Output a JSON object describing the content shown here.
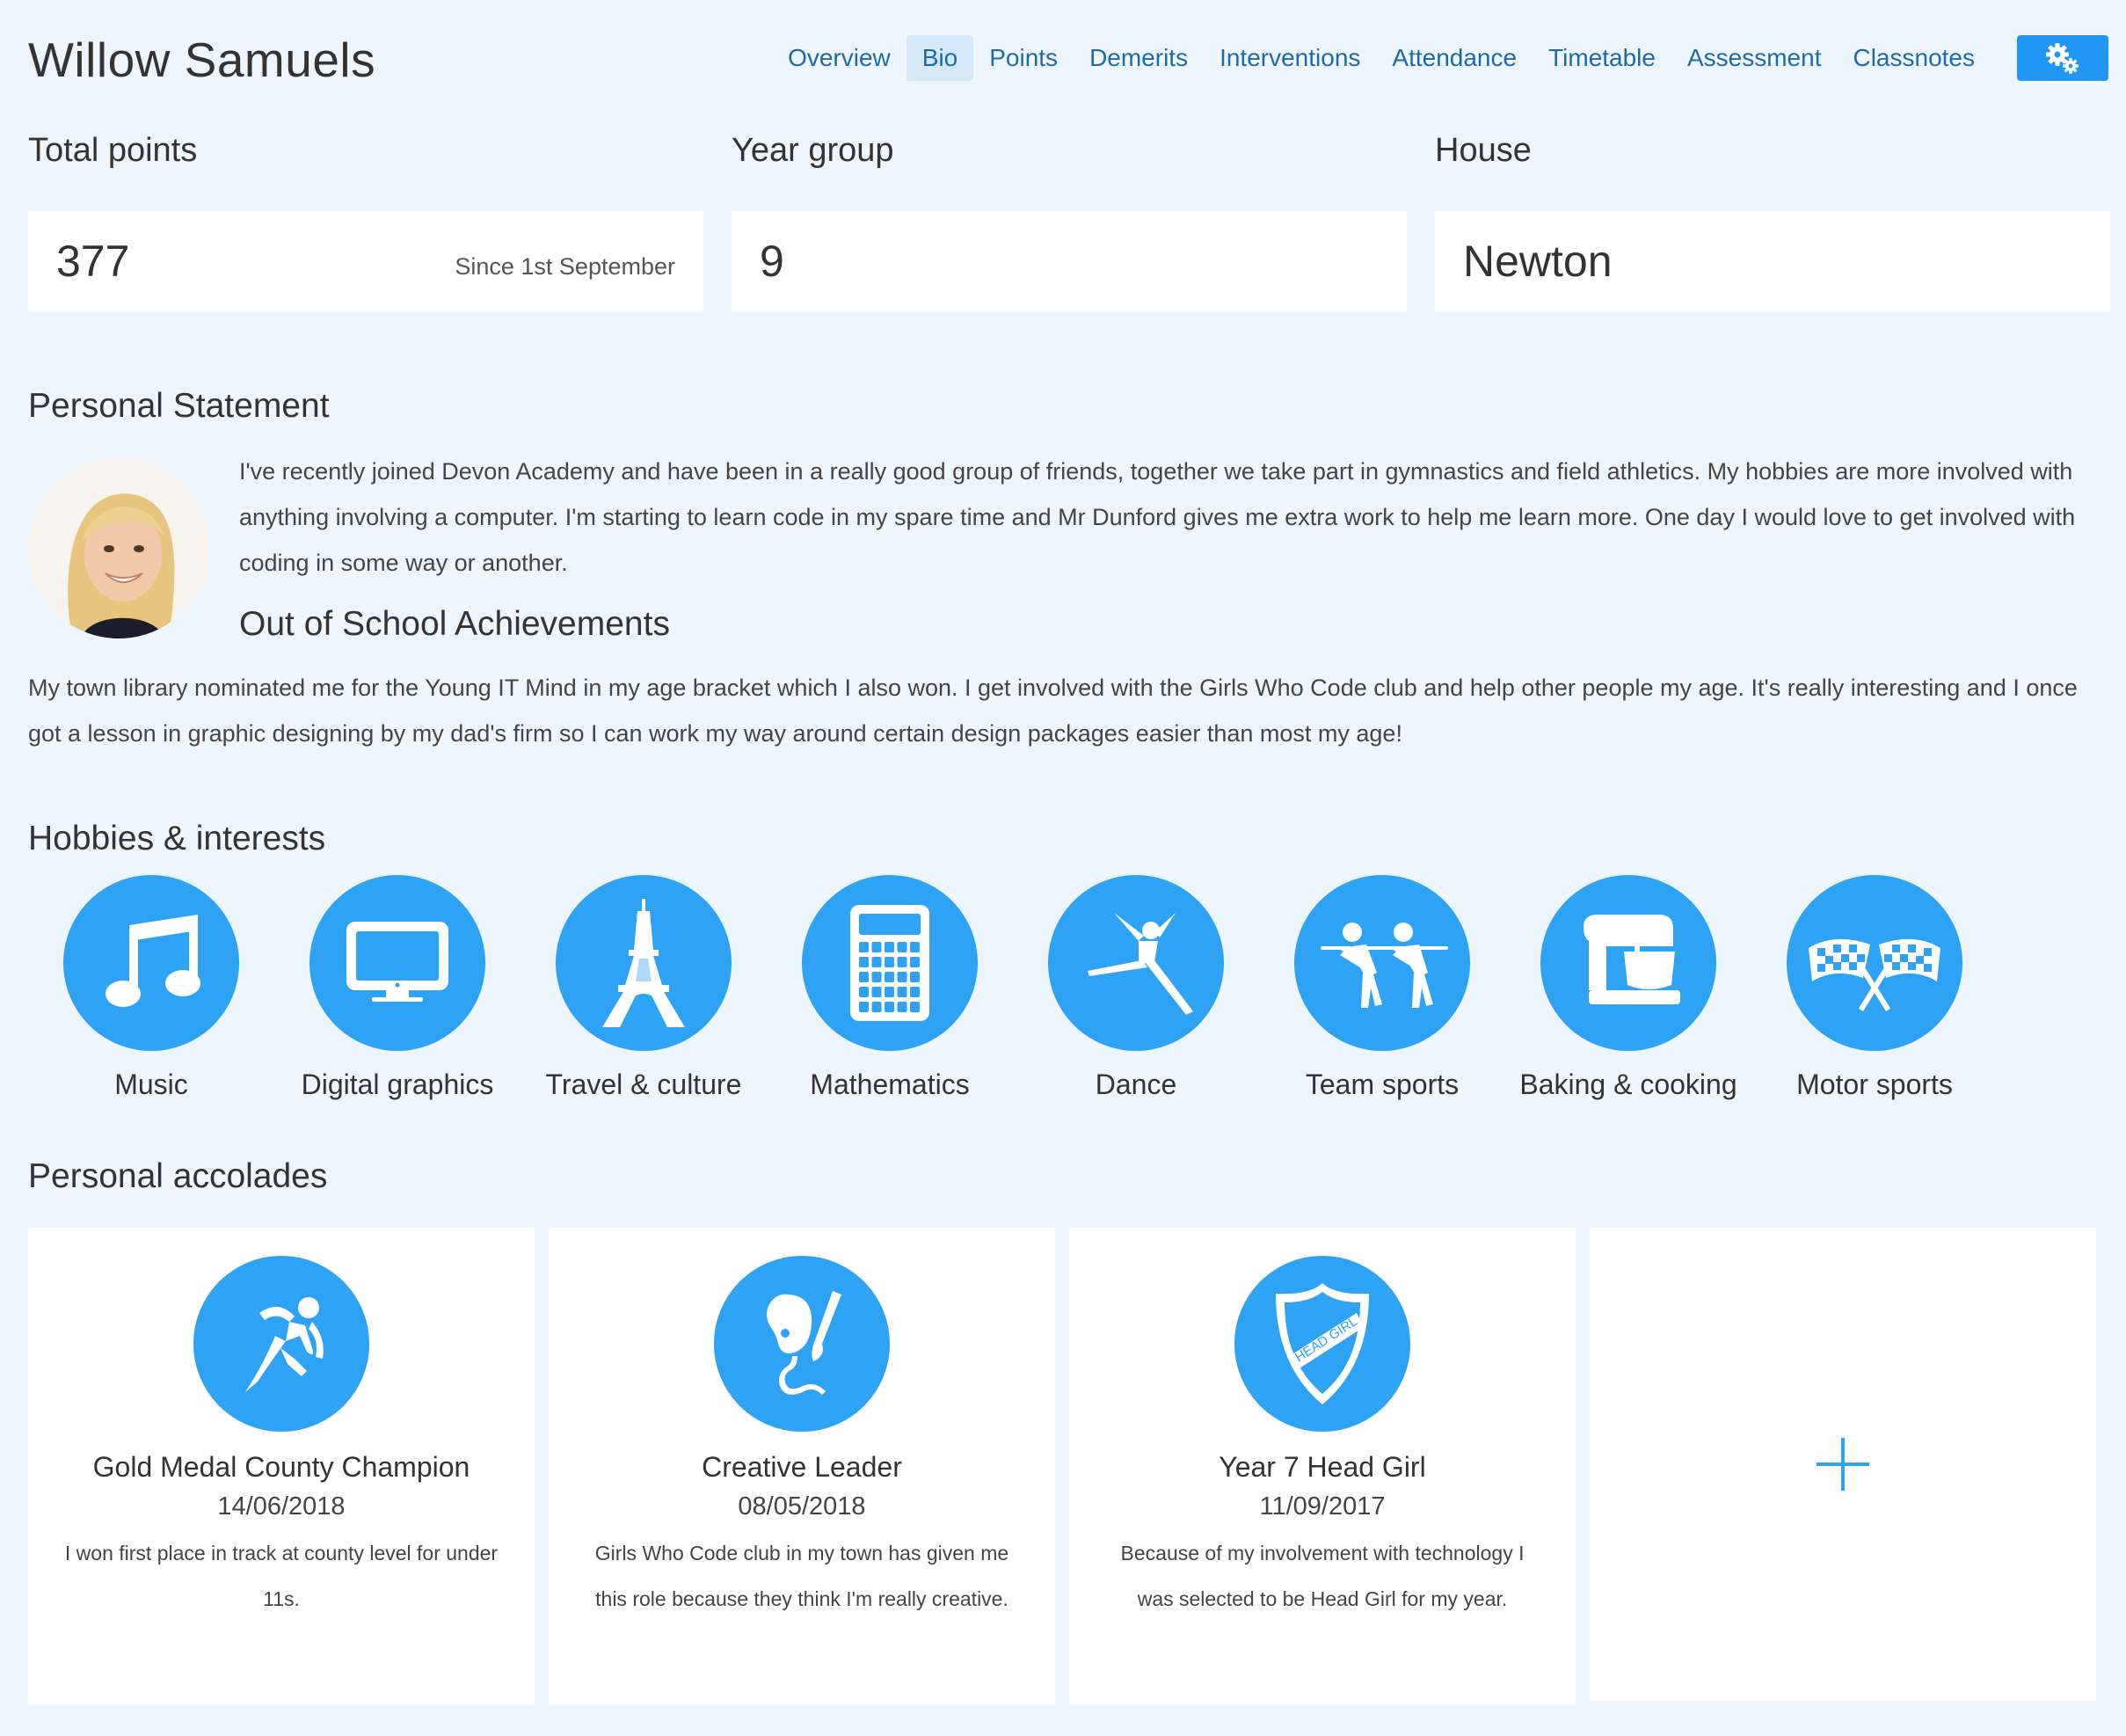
{
  "student": {
    "name": "Willow Samuels"
  },
  "nav": {
    "tabs": [
      {
        "label": "Overview"
      },
      {
        "label": "Bio",
        "active": true
      },
      {
        "label": "Points"
      },
      {
        "label": "Demerits"
      },
      {
        "label": "Interventions"
      },
      {
        "label": "Attendance"
      },
      {
        "label": "Timetable"
      },
      {
        "label": "Assessment"
      },
      {
        "label": "Classnotes"
      }
    ],
    "settings_icon": "gears-icon"
  },
  "stats": {
    "points": {
      "label": "Total points",
      "value": "377",
      "note": "Since 1st September"
    },
    "year": {
      "label": "Year group",
      "value": "9"
    },
    "house": {
      "label": "House",
      "value": "Newton"
    }
  },
  "statement": {
    "title": "Personal Statement",
    "text": "I've recently joined Devon Academy and have been in a really good group of friends, together we take part in gymnastics and field athletics. My hobbies are more involved with anything involving a computer. I'm starting to learn code in my spare time and Mr Dunford gives me extra work to help me learn more. One day I would love to get involved with coding in some way or another."
  },
  "achievements": {
    "title": "Out of School Achievements",
    "text": "My town library nominated me for the Young IT Mind in my age bracket which I also won. I get involved with the Girls Who Code club and help other people my age. It's really interesting and I once got a lesson in graphic designing by my dad's firm so I can work my way around certain design packages easier than most my age!"
  },
  "hobbies": {
    "title": "Hobbies & interests",
    "items": [
      {
        "label": "Music",
        "icon": "music-note-icon"
      },
      {
        "label": "Digital graphics",
        "icon": "monitor-icon"
      },
      {
        "label": "Travel & culture",
        "icon": "eiffel-tower-icon"
      },
      {
        "label": "Mathematics",
        "icon": "calculator-icon"
      },
      {
        "label": "Dance",
        "icon": "dancer-icon"
      },
      {
        "label": "Team sports",
        "icon": "tug-of-war-icon"
      },
      {
        "label": "Baking & cooking",
        "icon": "stand-mixer-icon"
      },
      {
        "label": "Motor sports",
        "icon": "checkered-flags-icon"
      }
    ]
  },
  "accolades": {
    "title": "Personal accolades",
    "items": [
      {
        "title": "Gold Medal County Champion",
        "date": "14/06/2018",
        "desc": "I won first place in track at county level for under 11s.",
        "icon": "runner-icon"
      },
      {
        "title": "Creative Leader",
        "date": "08/05/2018",
        "desc": "Girls Who Code club in my town has given me this role because they think I'm really creative.",
        "icon": "palette-brush-icon"
      },
      {
        "title": "Year 7 Head Girl",
        "date": "11/09/2017",
        "desc": "Because of my involvement with technology I was selected to be Head Girl for my year.",
        "icon": "head-girl-shield-icon",
        "badge_text": "HEAD GIRL"
      }
    ],
    "add_icon": "plus-icon"
  },
  "colors": {
    "accent": "#2ea2f4",
    "button": "#2196f3",
    "link": "#1e6aa8",
    "background": "#eef6fd"
  }
}
